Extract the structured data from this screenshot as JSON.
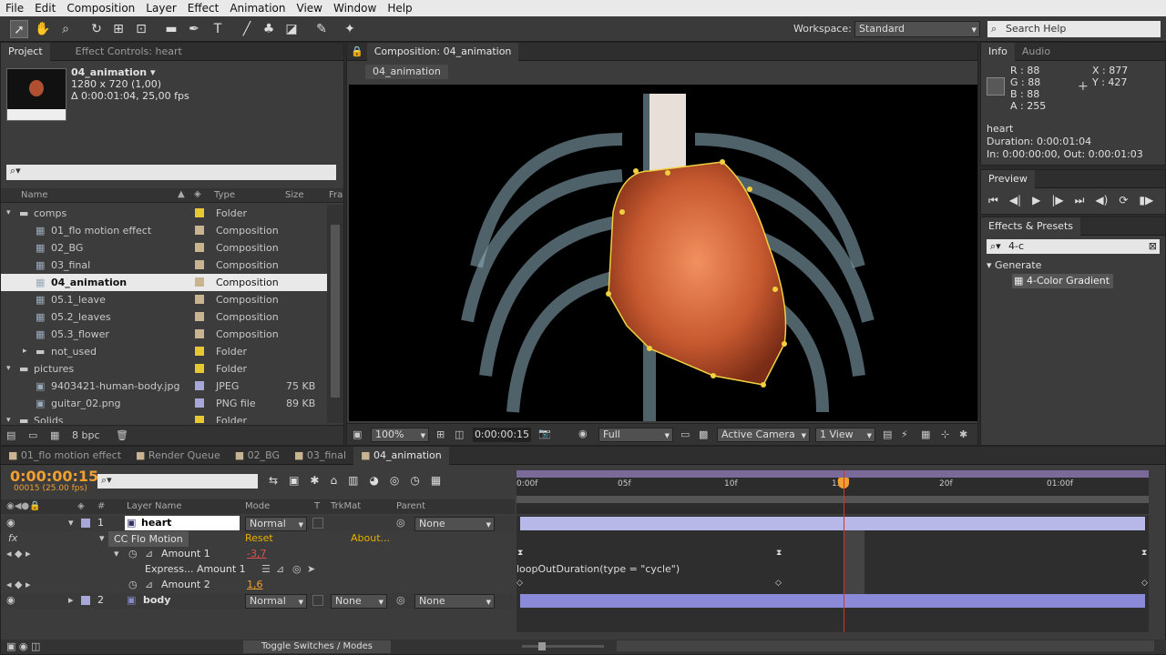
{
  "menu": [
    "File",
    "Edit",
    "Composition",
    "Layer",
    "Effect",
    "Animation",
    "View",
    "Window",
    "Help"
  ],
  "workspace": {
    "label": "Workspace:",
    "value": "Standard"
  },
  "search_help": {
    "placeholder": "Search Help"
  },
  "project_panel": {
    "tabs": [
      "Project",
      "Effect Controls: heart"
    ],
    "thumb_name": "04_animation ▾",
    "thumb_info1": "1280 x 720 (1,00)",
    "thumb_info2": "Δ 0:00:01:04, 25,00 fps",
    "columns": [
      "Name",
      "Type",
      "Size",
      "Fra"
    ],
    "items": [
      {
        "name": "comps",
        "type": "Folder",
        "size": "",
        "indent": 0,
        "kind": "folder",
        "color": "#e8c830"
      },
      {
        "name": "01_flo motion effect",
        "type": "Composition",
        "size": "",
        "indent": 1,
        "kind": "comp",
        "color": "#c8b490"
      },
      {
        "name": "02_BG",
        "type": "Composition",
        "size": "",
        "indent": 1,
        "kind": "comp",
        "color": "#c8b490"
      },
      {
        "name": "03_final",
        "type": "Composition",
        "size": "",
        "indent": 1,
        "kind": "comp",
        "color": "#c8b490"
      },
      {
        "name": "04_animation",
        "type": "Composition",
        "size": "",
        "indent": 1,
        "kind": "comp",
        "color": "#c8b490",
        "selected": true
      },
      {
        "name": "05.1_leave",
        "type": "Composition",
        "size": "",
        "indent": 1,
        "kind": "comp",
        "color": "#c8b490"
      },
      {
        "name": "05.2_leaves",
        "type": "Composition",
        "size": "",
        "indent": 1,
        "kind": "comp",
        "color": "#c8b490"
      },
      {
        "name": "05.3_flower",
        "type": "Composition",
        "size": "",
        "indent": 1,
        "kind": "comp",
        "color": "#c8b490"
      },
      {
        "name": "not_used",
        "type": "Folder",
        "size": "",
        "indent": 1,
        "kind": "folder",
        "color": "#e8c830"
      },
      {
        "name": "pictures",
        "type": "Folder",
        "size": "",
        "indent": 0,
        "kind": "folder",
        "color": "#e8c830"
      },
      {
        "name": "9403421-human-body.jpg",
        "type": "JPEG",
        "size": "75 KB",
        "indent": 1,
        "kind": "image",
        "color": "#a8a8d8"
      },
      {
        "name": "guitar_02.png",
        "type": "PNG file",
        "size": "89 KB",
        "indent": 1,
        "kind": "image",
        "color": "#a8a8d8"
      },
      {
        "name": "Solids",
        "type": "Folder",
        "size": "",
        "indent": 0,
        "kind": "folder",
        "color": "#e8c830"
      }
    ],
    "bpc": "8 bpc"
  },
  "comp_viewer": {
    "tab": "Composition: 04_animation",
    "breadcrumb": "04_animation",
    "zoom": "100%",
    "timecode": "0:00:00:15",
    "resolution": "Full",
    "camera": "Active Camera",
    "views": "1 View"
  },
  "info_panel": {
    "tabs": [
      "Info",
      "Audio"
    ],
    "r": "R : 88",
    "g": "G : 88",
    "b": "B : 88",
    "a": "A : 255",
    "x": "X : 877",
    "y": "Y : 427",
    "layer": "heart",
    "duration": "Duration: 0:00:01:04",
    "inout": "In: 0:00:00:00, Out: 0:00:01:03"
  },
  "preview_panel": {
    "title": "Preview"
  },
  "effects_panel": {
    "title": "Effects & Presets",
    "search": "4-c",
    "category": "Generate",
    "item": "4-Color Gradient"
  },
  "timeline": {
    "tabs": [
      "01_flo motion effect",
      "Render Queue",
      "02_BG",
      "03_final",
      "04_animation"
    ],
    "timecode": "0:00:00:15",
    "fps": "00015 (25.00 fps)",
    "columns": {
      "layer_name": "Layer Name",
      "mode": "Mode",
      "t": "T",
      "trkmat": "TrkMat",
      "parent": "Parent"
    },
    "ruler": [
      "0:00f",
      "05f",
      "10f",
      "15f",
      "20f",
      "01:00f"
    ],
    "layers": [
      {
        "num": "1",
        "name": "heart",
        "mode": "Normal",
        "trkmat": "",
        "parent": "None"
      },
      {
        "num": "2",
        "name": "body",
        "mode": "Normal",
        "trkmat": "None",
        "parent": "None"
      }
    ],
    "effect": {
      "name": "CC Flo Motion",
      "reset": "Reset",
      "about": "About..."
    },
    "amount1": {
      "label": "Amount 1",
      "value": "-3,7"
    },
    "expr": {
      "label": "Express... Amount 1",
      "text": "loopOutDuration(type = \"cycle\")"
    },
    "amount2": {
      "label": "Amount 2",
      "value": "1,6"
    },
    "toggle": "Toggle Switches / Modes"
  }
}
